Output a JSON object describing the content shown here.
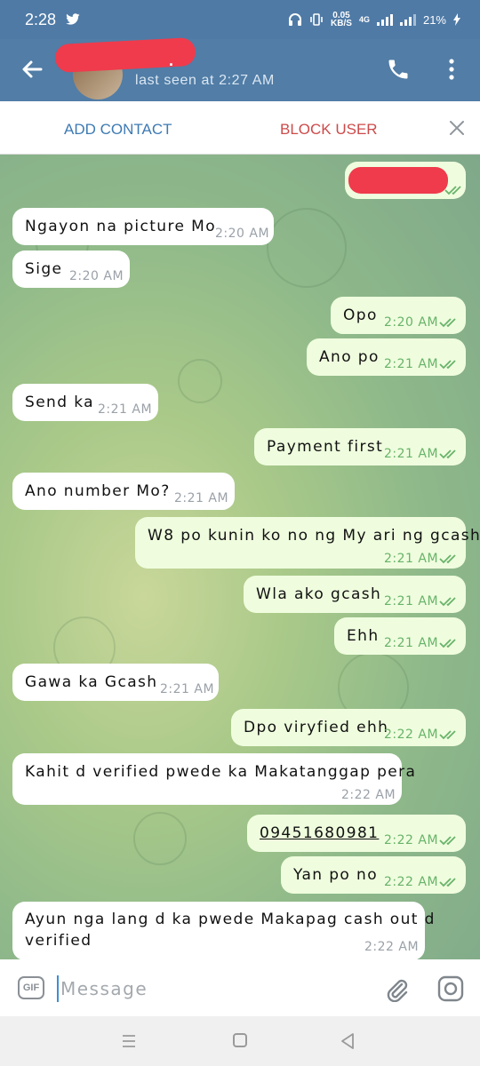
{
  "status": {
    "time": "2:28",
    "speed_value": "0.05",
    "speed_unit": "KB/S",
    "network": "4G",
    "battery": "21%"
  },
  "header": {
    "contact_name": ".",
    "last_seen": "last seen at 2:27 AM"
  },
  "actions": {
    "add_contact": "ADD CONTACT",
    "block_user": "BLOCK USER"
  },
  "messages": [
    {
      "dir": "out",
      "text": "",
      "time": ""
    },
    {
      "dir": "in",
      "text": "Ngayon na picture Mo",
      "time": "2:20 AM"
    },
    {
      "dir": "in",
      "text": "Sige",
      "time": "2:20 AM"
    },
    {
      "dir": "out",
      "text": "Opo",
      "time": "2:20 AM"
    },
    {
      "dir": "out",
      "text": "Ano po",
      "time": "2:21 AM"
    },
    {
      "dir": "in",
      "text": "Send ka",
      "time": "2:21 AM"
    },
    {
      "dir": "out",
      "text": "Payment first",
      "time": "2:21 AM"
    },
    {
      "dir": "in",
      "text": "Ano number Mo?",
      "time": "2:21 AM"
    },
    {
      "dir": "out",
      "text": "W8 po kunin ko no ng My ari ng gcash",
      "time": "2:21 AM"
    },
    {
      "dir": "out",
      "text": "Wla ako gcash",
      "time": "2:21 AM"
    },
    {
      "dir": "out",
      "text": "Ehh",
      "time": "2:21 AM"
    },
    {
      "dir": "in",
      "text": "Gawa ka Gcash",
      "time": "2:21 AM"
    },
    {
      "dir": "out",
      "text": "Dpo viryfied ehh",
      "time": "2:22 AM"
    },
    {
      "dir": "in",
      "text": "Kahit d verified pwede ka Makatanggap pera",
      "time": "2:22 AM"
    },
    {
      "dir": "out",
      "text": "09451680981",
      "time": "2:22 AM"
    },
    {
      "dir": "out",
      "text": "Yan po no",
      "time": "2:22 AM"
    },
    {
      "dir": "in",
      "text": "Ayun nga lang d ka pwede Makapag cash out d",
      "text2": "verified",
      "time": "2:22 AM"
    }
  ],
  "input": {
    "gif_label": "GIF",
    "placeholder": "Message"
  },
  "colors": {
    "header": "#517da6",
    "outgoing_bubble": "#effdde",
    "incoming_bubble": "#ffffff",
    "read_tick": "#68b36a"
  }
}
